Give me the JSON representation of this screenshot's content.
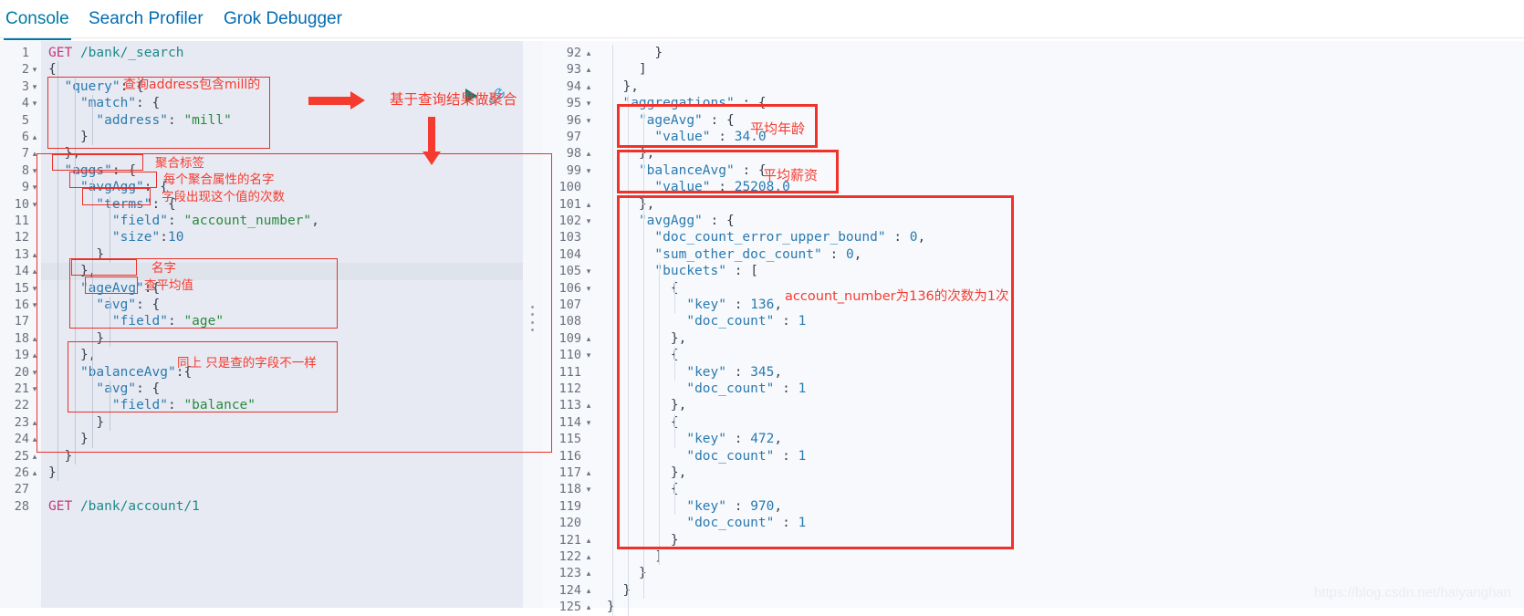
{
  "tabs": [
    {
      "id": "console",
      "label": "Console",
      "active": true
    },
    {
      "id": "search-profiler",
      "label": "Search Profiler",
      "active": false
    },
    {
      "id": "grok-debugger",
      "label": "Grok Debugger",
      "active": false
    }
  ],
  "toolbar": {
    "play_title": "Click to send request",
    "wrench_title": "Open documentation"
  },
  "left_editor": {
    "cursor_line": 14,
    "lines": [
      {
        "n": 1,
        "fold": "",
        "text": "GET /bank/_search"
      },
      {
        "n": 2,
        "fold": "▾",
        "text": "{"
      },
      {
        "n": 3,
        "fold": "▾",
        "text": "  \"query\": {"
      },
      {
        "n": 4,
        "fold": "▾",
        "text": "    \"match\": {"
      },
      {
        "n": 5,
        "fold": "",
        "text": "      \"address\": \"mill\""
      },
      {
        "n": 6,
        "fold": "▴",
        "text": "    }"
      },
      {
        "n": 7,
        "fold": "▴",
        "text": "  },"
      },
      {
        "n": 8,
        "fold": "▾",
        "text": "  \"aggs\": {"
      },
      {
        "n": 9,
        "fold": "▾",
        "text": "    \"avgAgg\": {"
      },
      {
        "n": 10,
        "fold": "▾",
        "text": "      \"terms\": {"
      },
      {
        "n": 11,
        "fold": "",
        "text": "        \"field\": \"account_number\","
      },
      {
        "n": 12,
        "fold": "",
        "text": "        \"size\":10"
      },
      {
        "n": 13,
        "fold": "▴",
        "text": "      }"
      },
      {
        "n": 14,
        "fold": "▴",
        "text": "    },"
      },
      {
        "n": 15,
        "fold": "▾",
        "text": "    \"ageAvg\":{"
      },
      {
        "n": 16,
        "fold": "▾",
        "text": "      \"avg\": {"
      },
      {
        "n": 17,
        "fold": "",
        "text": "        \"field\": \"age\""
      },
      {
        "n": 18,
        "fold": "▴",
        "text": "      }"
      },
      {
        "n": 19,
        "fold": "▴",
        "text": "    },"
      },
      {
        "n": 20,
        "fold": "▾",
        "text": "    \"balanceAvg\":{"
      },
      {
        "n": 21,
        "fold": "▾",
        "text": "      \"avg\": {"
      },
      {
        "n": 22,
        "fold": "",
        "text": "        \"field\": \"balance\""
      },
      {
        "n": 23,
        "fold": "▴",
        "text": "      }"
      },
      {
        "n": 24,
        "fold": "▴",
        "text": "    }"
      },
      {
        "n": 25,
        "fold": "▴",
        "text": "  }"
      },
      {
        "n": 26,
        "fold": "▴",
        "text": "}"
      },
      {
        "n": 27,
        "fold": "",
        "text": ""
      },
      {
        "n": 28,
        "fold": "",
        "text": "GET /bank/account/1"
      }
    ]
  },
  "right_editor": {
    "lines": [
      {
        "n": 92,
        "fold": "▴",
        "text": "      }"
      },
      {
        "n": 93,
        "fold": "▴",
        "text": "    ]"
      },
      {
        "n": 94,
        "fold": "▴",
        "text": "  },"
      },
      {
        "n": 95,
        "fold": "▾",
        "text": "  \"aggregations\" : {"
      },
      {
        "n": 96,
        "fold": "▾",
        "text": "    \"ageAvg\" : {"
      },
      {
        "n": 97,
        "fold": "",
        "text": "      \"value\" : 34.0"
      },
      {
        "n": 98,
        "fold": "▴",
        "text": "    },"
      },
      {
        "n": 99,
        "fold": "▾",
        "text": "    \"balanceAvg\" : {"
      },
      {
        "n": 100,
        "fold": "",
        "text": "      \"value\" : 25208.0"
      },
      {
        "n": 101,
        "fold": "▴",
        "text": "    },"
      },
      {
        "n": 102,
        "fold": "▾",
        "text": "    \"avgAgg\" : {"
      },
      {
        "n": 103,
        "fold": "",
        "text": "      \"doc_count_error_upper_bound\" : 0,"
      },
      {
        "n": 104,
        "fold": "",
        "text": "      \"sum_other_doc_count\" : 0,"
      },
      {
        "n": 105,
        "fold": "▾",
        "text": "      \"buckets\" : ["
      },
      {
        "n": 106,
        "fold": "▾",
        "text": "        {"
      },
      {
        "n": 107,
        "fold": "",
        "text": "          \"key\" : 136,"
      },
      {
        "n": 108,
        "fold": "",
        "text": "          \"doc_count\" : 1"
      },
      {
        "n": 109,
        "fold": "▴",
        "text": "        },"
      },
      {
        "n": 110,
        "fold": "▾",
        "text": "        {"
      },
      {
        "n": 111,
        "fold": "",
        "text": "          \"key\" : 345,"
      },
      {
        "n": 112,
        "fold": "",
        "text": "          \"doc_count\" : 1"
      },
      {
        "n": 113,
        "fold": "▴",
        "text": "        },"
      },
      {
        "n": 114,
        "fold": "▾",
        "text": "        {"
      },
      {
        "n": 115,
        "fold": "",
        "text": "          \"key\" : 472,"
      },
      {
        "n": 116,
        "fold": "",
        "text": "          \"doc_count\" : 1"
      },
      {
        "n": 117,
        "fold": "▴",
        "text": "        },"
      },
      {
        "n": 118,
        "fold": "▾",
        "text": "        {"
      },
      {
        "n": 119,
        "fold": "",
        "text": "          \"key\" : 970,"
      },
      {
        "n": 120,
        "fold": "",
        "text": "          \"doc_count\" : 1"
      },
      {
        "n": 121,
        "fold": "▴",
        "text": "        }"
      },
      {
        "n": 122,
        "fold": "▴",
        "text": "      ]"
      },
      {
        "n": 123,
        "fold": "▴",
        "text": "    }"
      },
      {
        "n": 124,
        "fold": "▴",
        "text": "  }"
      },
      {
        "n": 125,
        "fold": "▴",
        "text": "}"
      }
    ]
  },
  "annotations": {
    "query_note": "查询address包含mill的",
    "aggs_label": "聚合标签",
    "avgagg_note": "每个聚合属性的名字",
    "terms_note": "字段出现这个值的次数",
    "ageavg_note": "名字",
    "avg_note": "查平均值",
    "balanceavg_note": "同上 只是查的字段不一样",
    "arrow_note": "基于查询结果做聚合",
    "age_value_note": "平均年龄",
    "balance_value_note": "平均薪资",
    "bucket_note": "account_number为136的次数为1次"
  },
  "watermark": "https://blog.csdn.net/haiyanghan",
  "colors": {
    "accent": "#006bb4",
    "tab_active": "#0079a5",
    "annotation_red": "#f53b30",
    "box_red": "#e8312a",
    "play_green": "#017d73",
    "left_pane_bg": "#e7eaf2",
    "right_pane_bg": "#f7f9fc"
  }
}
